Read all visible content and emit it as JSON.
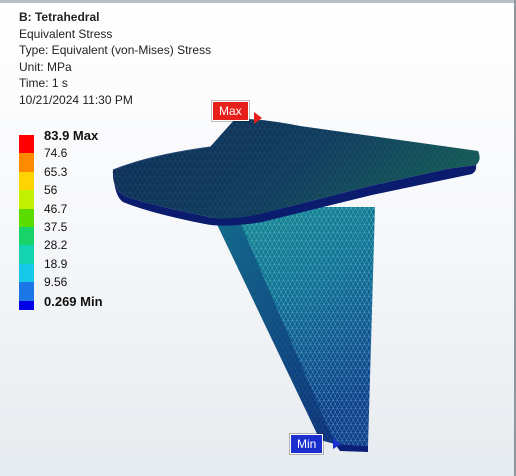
{
  "result": {
    "title": "B: Tetrahedral",
    "quantity": "Equivalent Stress",
    "type": "Type: Equivalent (von-Mises) Stress",
    "unit": "Unit: MPa",
    "time": "Time: 1 s",
    "timestamp": "10/21/2024 11:30 PM"
  },
  "legend": {
    "ticks": [
      {
        "label": "83.9 Max",
        "value": 83.9,
        "bold": true
      },
      {
        "label": "74.6",
        "value": 74.6
      },
      {
        "label": "65.3",
        "value": 65.3
      },
      {
        "label": "56",
        "value": 56
      },
      {
        "label": "46.7",
        "value": 46.7
      },
      {
        "label": "37.5",
        "value": 37.5
      },
      {
        "label": "28.2",
        "value": 28.2
      },
      {
        "label": "18.9",
        "value": 18.9
      },
      {
        "label": "9.56",
        "value": 9.56
      },
      {
        "label": "0.269 Min",
        "value": 0.269,
        "bold": true
      }
    ],
    "band_colors": [
      "#ff0000",
      "#ff8a00",
      "#ffd400",
      "#c3f000",
      "#5bdc00",
      "#18d36a",
      "#14d3b0",
      "#17c8e8",
      "#1b76e6",
      "#0000e6"
    ]
  },
  "probes": {
    "max_label": "Max",
    "min_label": "Min",
    "max_color": "#e8201c",
    "min_color": "#1b2fcf"
  }
}
